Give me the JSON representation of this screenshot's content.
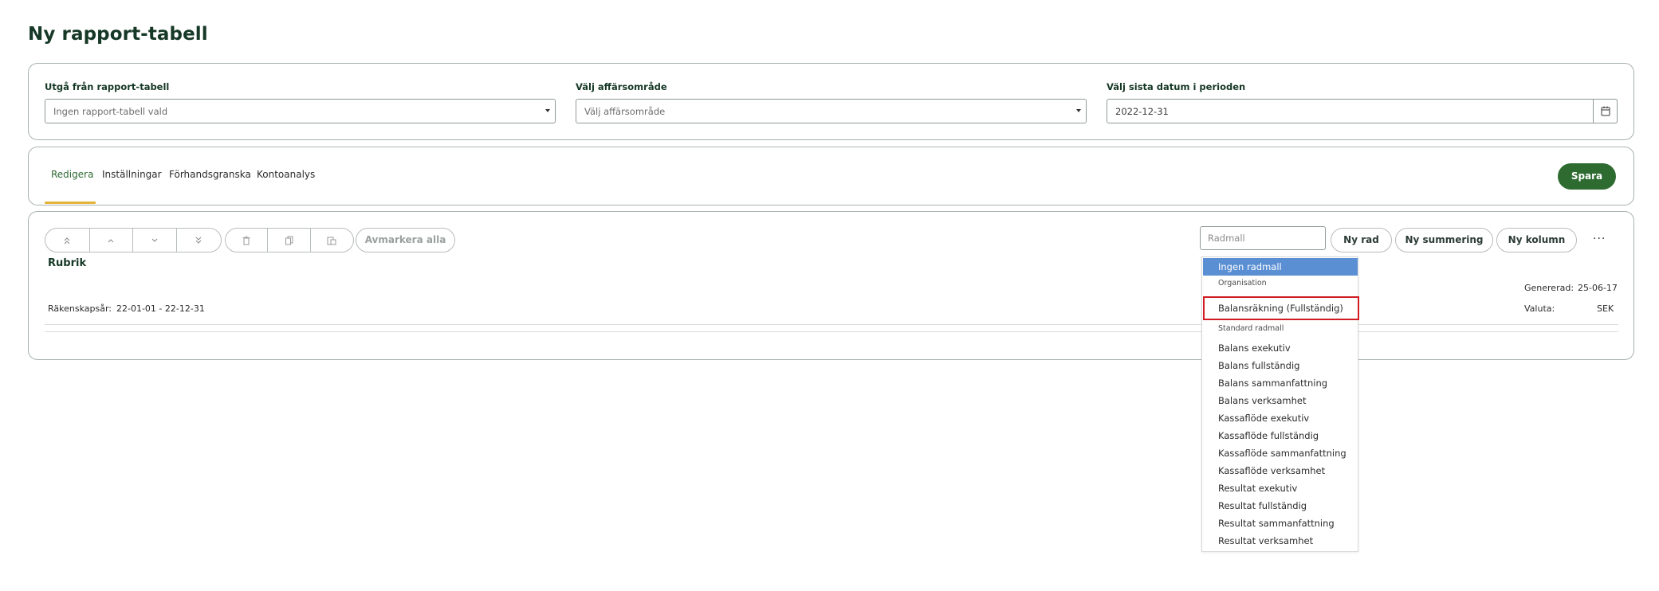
{
  "page": {
    "title": "Ny rapport-tabell"
  },
  "filters": {
    "template": {
      "label": "Utgå från rapport-tabell",
      "value": "Ingen rapport-tabell vald"
    },
    "business_area": {
      "label": "Välj affärsområde",
      "value": "Välj affärsområde"
    },
    "period_end": {
      "label": "Välj sista datum i perioden",
      "value": "2022-12-31"
    }
  },
  "tabs": [
    {
      "label": "Redigera",
      "active": true
    },
    {
      "label": "Inställningar",
      "active": false
    },
    {
      "label": "Förhandsgranska",
      "active": false
    },
    {
      "label": "Kontoanalys",
      "active": false
    }
  ],
  "save_label": "Spara",
  "toolbar": {
    "move_buttons": [
      "chevrons-up-icon",
      "chevron-up-icon",
      "chevron-down-icon",
      "chevrons-down-icon"
    ],
    "edit_buttons": [
      "trash-icon",
      "copy-icon",
      "paste-icon"
    ],
    "deselect_all": "Avmarkera alla",
    "radmall_placeholder": "Radmall",
    "new_row": "Ny rad",
    "new_sum": "Ny summering",
    "new_column": "Ny kolumn",
    "more": "···"
  },
  "report": {
    "heading": "Rubrik",
    "fiscal_label": "Räkenskapsår:",
    "fiscal_value": "22-01-01 - 22-12-31",
    "generated_label": "Genererad:",
    "generated_value": "25-06-17",
    "currency_label": "Valuta:",
    "currency_value": "SEK"
  },
  "dropdown": {
    "selected": "Ingen radmall",
    "group_org": "Organisation",
    "org_item": "Balansräkning (Fullständig)",
    "group_standard": "Standard radmall",
    "items": [
      "Balans exekutiv",
      "Balans fullständig",
      "Balans sammanfattning",
      "Balans verksamhet",
      "Kassaflöde exekutiv",
      "Kassaflöde fullständig",
      "Kassaflöde sammanfattning",
      "Kassaflöde verksamhet",
      "Resultat exekutiv",
      "Resultat fullständig",
      "Resultat sammanfattning",
      "Resultat verksamhet"
    ]
  },
  "colors": {
    "primary": "#2e6b31",
    "tab_accent": "#e4b43a",
    "selected_option": "#5b8fd3",
    "highlight_border": "#d01c22"
  }
}
